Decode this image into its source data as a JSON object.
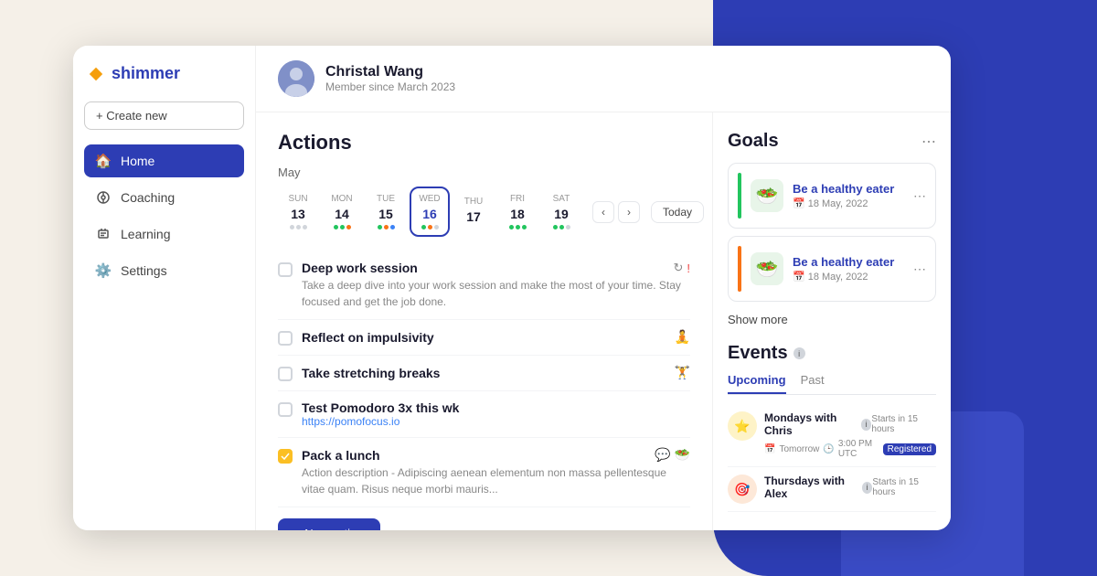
{
  "app": {
    "name": "shimmer"
  },
  "sidebar": {
    "create_new": "+ Create new",
    "nav": [
      {
        "id": "home",
        "label": "Home",
        "icon": "🏠",
        "active": true
      },
      {
        "id": "coaching",
        "label": "Coaching",
        "icon": "👁️"
      },
      {
        "id": "learning",
        "label": "Learning",
        "icon": "🎓"
      },
      {
        "id": "settings",
        "label": "Settings",
        "icon": "⚙️"
      }
    ]
  },
  "user": {
    "name": "Christal Wang",
    "since": "Member since March 2023"
  },
  "actions": {
    "title": "Actions",
    "month": "May",
    "week": [
      {
        "day": "SUN",
        "num": "13",
        "dots": [
          "gray",
          "gray",
          "gray"
        ]
      },
      {
        "day": "MON",
        "num": "14",
        "dots": [
          "green",
          "green",
          "orange"
        ]
      },
      {
        "day": "TUE",
        "num": "15",
        "dots": [
          "green",
          "orange",
          "blue"
        ]
      },
      {
        "day": "WED",
        "num": "16",
        "dots": [
          "green",
          "orange",
          "gray"
        ],
        "active": true
      },
      {
        "day": "THU",
        "num": "17",
        "dots": []
      },
      {
        "day": "FRI",
        "num": "18",
        "dots": [
          "green",
          "green",
          "green"
        ]
      },
      {
        "day": "SAT",
        "num": "19",
        "dots": [
          "green",
          "green",
          "gray"
        ]
      }
    ],
    "today_btn": "Today",
    "items": [
      {
        "id": "deep-work",
        "title": "Deep work session",
        "desc": "Take a deep dive into your work session and make the most of your time. Stay focused and get the job done.",
        "checked": false,
        "badge_refresh": true,
        "badge_warning": true
      },
      {
        "id": "reflect",
        "title": "Reflect on impulsivity",
        "desc": "",
        "checked": false,
        "emoji": "🧘"
      },
      {
        "id": "stretching",
        "title": "Take stretching breaks",
        "desc": "",
        "checked": false,
        "emoji": "🏋️"
      },
      {
        "id": "pomodoro",
        "title": "Test Pomodoro 3x this wk",
        "link": "https://pomofocus.io",
        "checked": false
      },
      {
        "id": "lunch",
        "title": "Pack a lunch",
        "desc": "Action description - Adipiscing aenean elementum non massa pellentesque vitae quam. Risus neque morbi mauris...",
        "checked": true,
        "emoji1": "💬",
        "emoji2": "🥗"
      }
    ],
    "new_action": "+ New action"
  },
  "goals": {
    "title": "Goals",
    "items": [
      {
        "name": "Be a healthy eater",
        "date": "18 May, 2022",
        "color": "#22c55e",
        "emoji": "🥗"
      },
      {
        "name": "Be a healthy eater",
        "date": "18 May, 2022",
        "color": "#f97316",
        "emoji": "🥗"
      }
    ],
    "show_more": "Show more"
  },
  "events": {
    "title": "Events",
    "tabs": [
      "Upcoming",
      "Past"
    ],
    "active_tab": "Upcoming",
    "items": [
      {
        "name": "Mondays with Chris",
        "when": "Tomorrow",
        "time": "3:00 PM UTC",
        "starts": "Starts in 15 hours",
        "registered": true,
        "emoji": "⭐"
      },
      {
        "name": "Thursdays with Alex",
        "when": "",
        "time": "",
        "starts": "Starts in 15 hours",
        "registered": false,
        "emoji": "🎯"
      }
    ]
  }
}
